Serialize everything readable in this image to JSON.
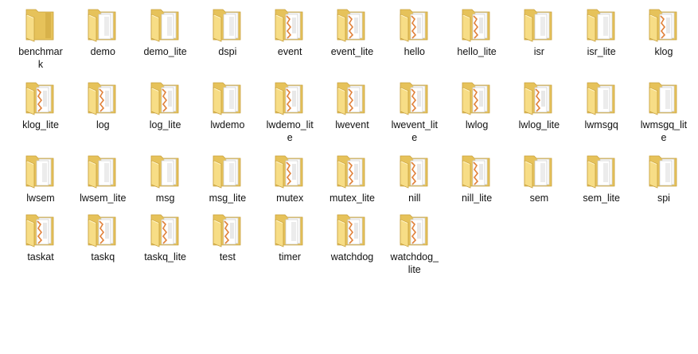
{
  "window": {
    "view": "large-icons"
  },
  "colors": {
    "folder_back": "#e6c25a",
    "folder_front": "#f7dd86",
    "folder_edge": "#c9a13d",
    "paper": "#ffffff",
    "accent_orange": "#e1813a",
    "label_text": "#111111"
  },
  "items": [
    {
      "name": "benchmark",
      "display": "benchmar k",
      "icon": "folder-dark-icon"
    },
    {
      "name": "demo",
      "display": "demo",
      "icon": "folder-doc-icon"
    },
    {
      "name": "demo_lite",
      "display": "demo_lite",
      "icon": "folder-doc-icon"
    },
    {
      "name": "dspi",
      "display": "dspi",
      "icon": "folder-doc-icon"
    },
    {
      "name": "event",
      "display": "event",
      "icon": "folder-orange-doc-icon"
    },
    {
      "name": "event_lite",
      "display": "event_lite",
      "icon": "folder-orange-doc-icon"
    },
    {
      "name": "hello",
      "display": "hello",
      "icon": "folder-orange-doc-icon"
    },
    {
      "name": "hello_lite",
      "display": "hello_lite",
      "icon": "folder-orange-doc-icon"
    },
    {
      "name": "isr",
      "display": "isr",
      "icon": "folder-doc-icon"
    },
    {
      "name": "isr_lite",
      "display": "isr_lite",
      "icon": "folder-doc-icon"
    },
    {
      "name": "klog",
      "display": "klog",
      "icon": "folder-orange-doc-icon"
    },
    {
      "name": "klog_lite",
      "display": "klog_lite",
      "icon": "folder-orange-doc-icon"
    },
    {
      "name": "log",
      "display": "log",
      "icon": "folder-orange-doc-icon"
    },
    {
      "name": "log_lite",
      "display": "log_lite",
      "icon": "folder-orange-doc-icon"
    },
    {
      "name": "lwdemo",
      "display": "lwdemo",
      "icon": "folder-doc-icon"
    },
    {
      "name": "lwdemo_lite",
      "display": "lwdemo_lit e",
      "icon": "folder-orange-doc-icon"
    },
    {
      "name": "lwevent",
      "display": "lwevent",
      "icon": "folder-orange-doc-icon"
    },
    {
      "name": "lwevent_lite",
      "display": "lwevent_lit e",
      "icon": "folder-orange-doc-icon"
    },
    {
      "name": "lwlog",
      "display": "lwlog",
      "icon": "folder-orange-doc-icon"
    },
    {
      "name": "lwlog_lite",
      "display": "lwlog_lite",
      "icon": "folder-orange-doc-icon"
    },
    {
      "name": "lwmsgq",
      "display": "lwmsgq",
      "icon": "folder-doc-icon"
    },
    {
      "name": "lwmsgq_lite",
      "display": "lwmsgq_lit e",
      "icon": "folder-doc-icon"
    },
    {
      "name": "lwsem",
      "display": "lwsem",
      "icon": "folder-doc-icon"
    },
    {
      "name": "lwsem_lite",
      "display": "lwsem_lite",
      "icon": "folder-doc-icon"
    },
    {
      "name": "msg",
      "display": "msg",
      "icon": "folder-doc-icon"
    },
    {
      "name": "msg_lite",
      "display": "msg_lite",
      "icon": "folder-doc-icon"
    },
    {
      "name": "mutex",
      "display": "mutex",
      "icon": "folder-orange-doc-icon"
    },
    {
      "name": "mutex_lite",
      "display": "mutex_lite",
      "icon": "folder-orange-doc-icon"
    },
    {
      "name": "nill",
      "display": "nill",
      "icon": "folder-orange-doc-icon"
    },
    {
      "name": "nill_lite",
      "display": "nill_lite",
      "icon": "folder-orange-doc-icon"
    },
    {
      "name": "sem",
      "display": "sem",
      "icon": "folder-doc-icon"
    },
    {
      "name": "sem_lite",
      "display": "sem_lite",
      "icon": "folder-doc-icon"
    },
    {
      "name": "spi",
      "display": "spi",
      "icon": "folder-doc-icon"
    },
    {
      "name": "taskat",
      "display": "taskat",
      "icon": "folder-orange-doc-icon"
    },
    {
      "name": "taskq",
      "display": "taskq",
      "icon": "folder-orange-doc-icon"
    },
    {
      "name": "taskq_lite",
      "display": "taskq_lite",
      "icon": "folder-orange-doc-icon"
    },
    {
      "name": "test",
      "display": "test",
      "icon": "folder-orange-doc-icon"
    },
    {
      "name": "timer",
      "display": "timer",
      "icon": "folder-doc-icon"
    },
    {
      "name": "watchdog",
      "display": "watchdog",
      "icon": "folder-orange-doc-icon"
    },
    {
      "name": "watchdog_lite",
      "display": "watchdog_ lite",
      "icon": "folder-orange-doc-icon"
    }
  ]
}
